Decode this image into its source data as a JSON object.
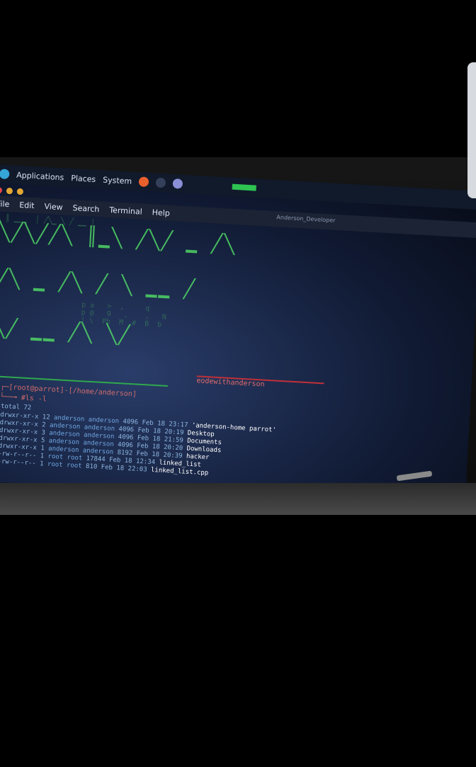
{
  "panel": {
    "applications": "Applications",
    "places": "Places",
    "system": "System"
  },
  "menubar": {
    "items": [
      "File",
      "Edit",
      "View",
      "Search",
      "Terminal",
      "Help"
    ],
    "window_title": "Anderson_Developer"
  },
  "terminal": {
    "prompt_user": "[root@parrot]",
    "prompt_path": "-[/home/anderson]",
    "command": "#ls -l",
    "total": "total 72",
    "listing": [
      {
        "perm": "drwxr-xr-x",
        "links": "12",
        "owner": "anderson",
        "group": "anderson",
        "size": "4096",
        "date": "Feb 18 23:17",
        "name": "'anderson-home parrot'"
      },
      {
        "perm": "drwxr-xr-x",
        "links": "2",
        "owner": "anderson",
        "group": "anderson",
        "size": "4096",
        "date": "Feb 18 20:19",
        "name": "Desktop"
      },
      {
        "perm": "drwxr-xr-x",
        "links": "3",
        "owner": "anderson",
        "group": "anderson",
        "size": "4096",
        "date": "Feb 18 21:59",
        "name": "Documents"
      },
      {
        "perm": "drwxr-xr-x",
        "links": "5",
        "owner": "anderson",
        "group": "anderson",
        "size": "4096",
        "date": "Feb 18 20:20",
        "name": "Downloads"
      },
      {
        "perm": "drwxr-xr-x",
        "links": "1",
        "owner": "anderson",
        "group": "anderson",
        "size": "8192",
        "date": "Feb 18 20:39",
        "name": "hacker"
      },
      {
        "perm": "-rw-r--r--",
        "links": "1",
        "owner": "root",
        "group": "root",
        "size": "17844",
        "date": "Feb 18 12:34",
        "name": "linked_list"
      },
      {
        "perm": "-rw-r--r--",
        "links": "1",
        "owner": "root",
        "group": "root",
        "size": "810",
        "date": "Feb 18 22:03",
        "name": "linked_list.cpp"
      }
    ],
    "overlay_text": "eodewithanderson"
  },
  "colors": {
    "green": "#4fd465",
    "red": "#c0303a",
    "screen_blue": "#2a3d6a"
  }
}
